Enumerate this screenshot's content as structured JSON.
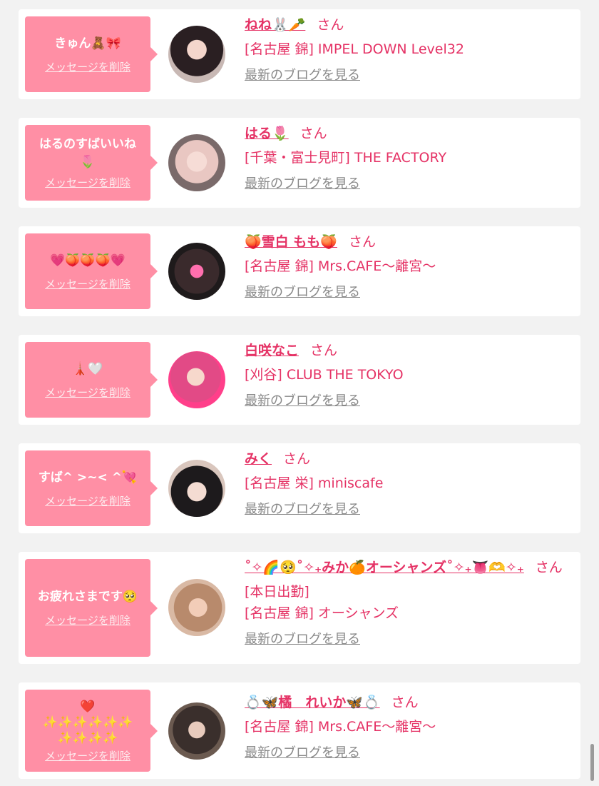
{
  "accent_color": "#e53265",
  "bubble_color": "#ff8fa5",
  "messages": [
    {
      "message": "きゅん🧸🎀",
      "delete_label": "メッセージを削除",
      "name": "ねね🐰🥕",
      "honorific": "さん",
      "extra": "",
      "shop": "[名古屋 錦] IMPEL DOWN Level32",
      "blog_link": "最新のブログを見る",
      "avatar_icon": "avatar-photo"
    },
    {
      "message": "はるのすばいいね\n🌷",
      "delete_label": "メッセージを削除",
      "name": "はる🌷",
      "honorific": "さん",
      "extra": "",
      "shop": "[千葉・富士見町] THE FACTORY",
      "blog_link": "最新のブログを見る",
      "avatar_icon": "avatar-photo"
    },
    {
      "message": "💗🍑🍑🍑💗",
      "delete_label": "メッセージを削除",
      "name": "🍑雪白 もも🍑",
      "honorific": "さん",
      "extra": "",
      "shop": "[名古屋 錦] Mrs.CAFE〜離宮〜",
      "blog_link": "最新のブログを見る",
      "avatar_icon": "avatar-photo"
    },
    {
      "message": "🗼🤍",
      "delete_label": "メッセージを削除",
      "name": "白咲なこ",
      "honorific": "さん",
      "extra": "",
      "shop": "[刈谷] CLUB THE TOKYO",
      "blog_link": "最新のブログを見る",
      "avatar_icon": "avatar-photo"
    },
    {
      "message": "すば^ >~< ^💘",
      "delete_label": "メッセージを削除",
      "name": "みく",
      "honorific": "さん",
      "extra": "",
      "shop": "[名古屋 栄] miniscafe",
      "blog_link": "最新のブログを見る",
      "avatar_icon": "avatar-photo"
    },
    {
      "message": "お疲れさまです🥺",
      "delete_label": "メッセージを削除",
      "name": "˚✧🌈🥺˚✧₊みか🍊オーシャンズ˚✧₊👅🫶✧₊",
      "honorific": "さん",
      "extra": "[本日出勤]",
      "shop": "[名古屋 錦] オーシャンズ",
      "blog_link": "最新のブログを見る",
      "avatar_icon": "avatar-photo"
    },
    {
      "message": "❤️\n✨✨✨✨✨✨\n✨✨✨✨",
      "delete_label": "メッセージを削除",
      "name": "💍🦋橘　れいか🦋💍",
      "honorific": "さん",
      "extra": "",
      "shop": "[名古屋 錦] Mrs.CAFE〜離宮〜",
      "blog_link": "最新のブログを見る",
      "avatar_icon": "avatar-photo"
    }
  ]
}
